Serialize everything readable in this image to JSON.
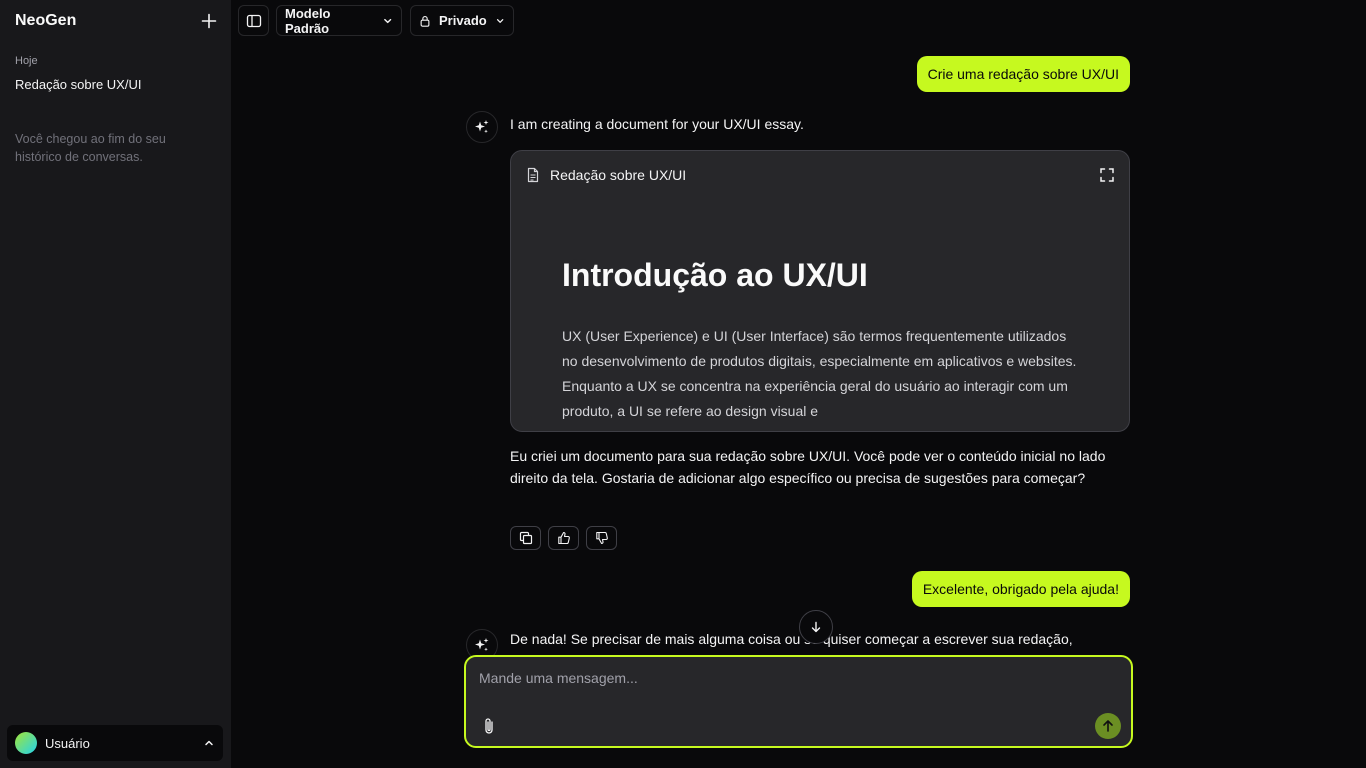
{
  "app": {
    "name": "NeoGen"
  },
  "sidebar": {
    "section_label": "Hoje",
    "items": [
      {
        "label": "Redação sobre UX/UI"
      }
    ],
    "end_message": "Você chegou ao fim do seu histórico de conversas.",
    "user": {
      "name": "Usuário"
    }
  },
  "topbar": {
    "model": "Modelo Padrão",
    "visibility": "Privado"
  },
  "chat": {
    "messages": [
      {
        "role": "user",
        "text": "Crie uma redação sobre UX/UI"
      },
      {
        "role": "assistant",
        "text": "I am creating a document for your UX/UI essay."
      },
      {
        "role": "assistant",
        "text": "Eu criei um documento para sua redação sobre UX/UI. Você pode ver o conteúdo inicial no lado direito da tela. Gostaria de adicionar algo específico ou precisa de sugestões para começar?"
      },
      {
        "role": "user",
        "text": "Excelente, obrigado pela ajuda!"
      },
      {
        "role": "assistant",
        "text": "De nada! Se precisar de mais alguma coisa ou se quiser começar a escrever sua redação,"
      }
    ],
    "document": {
      "title": "Redação sobre UX/UI",
      "heading": "Introdução ao UX/UI",
      "body": "UX (User Experience) e UI (User Interface) são termos frequentemente utilizados no desenvolvimento de produtos digitais, especialmente em aplicativos e websites. Enquanto a UX se concentra na experiência geral do usuário ao interagir com um produto, a UI se refere ao design visual e"
    }
  },
  "composer": {
    "placeholder": "Mande uma mensagem..."
  },
  "colors": {
    "accent": "#c6f91f",
    "background": "#09090b",
    "sidebar": "#18181b",
    "card": "#27272a"
  }
}
